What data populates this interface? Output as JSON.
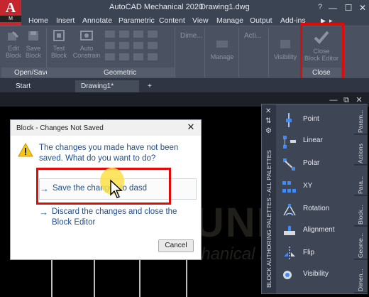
{
  "app": {
    "title": "AutoCAD Mechanical 2020",
    "document": "Drawing1.dwg",
    "logo_letter": "A",
    "logo_sub": "M",
    "brand_color": "#c6262e"
  },
  "quick_access": [
    "?",
    "▶"
  ],
  "window_controls": [
    "—",
    "☐",
    "✕"
  ],
  "ribbon_tabs": [
    "Home",
    "Insert",
    "Annotate",
    "Parametric",
    "Content",
    "View",
    "Manage",
    "Output",
    "Add-ins"
  ],
  "ribbon_tab_more": "▸",
  "ribbon": {
    "open_save": {
      "buttons": [
        {
          "label1": "Edit",
          "label2": "Block"
        },
        {
          "label1": "Save",
          "label2": "Block"
        }
      ],
      "title": "Open/Save"
    },
    "test_block": {
      "label1": "Test",
      "label2": "Block"
    },
    "auto_constrain": {
      "label1": "Auto",
      "label2": "Constrain"
    },
    "geometric": {
      "title": "Geometric"
    },
    "dimension": {
      "label": "Dime..."
    },
    "manage": {
      "label": "Manage"
    },
    "actions": {
      "label": "Acti..."
    },
    "visibility": {
      "label": "Visibility"
    },
    "close": {
      "label1": "Close",
      "label2": "Block Editor",
      "title": "Close"
    }
  },
  "file_tabs": [
    {
      "label": "Start"
    },
    {
      "label": "Drawing1*"
    }
  ],
  "new_tab": "+",
  "dialog": {
    "title": "Block - Changes Not Saved",
    "close": "✕",
    "message": "The changes you made have not been saved. What do you want to do?",
    "option_save": "Save the changes to dasd",
    "option_discard": "Discard the changes and close the Block Editor",
    "arrow": "→",
    "cancel": "Cancel"
  },
  "palette": {
    "title": "BLOCK AUTHORING PALETTES - ALL PALETTES",
    "items": [
      "Point",
      "Linear",
      "Polar",
      "XY",
      "Rotation",
      "Alignment",
      "Flip",
      "Visibility"
    ],
    "tabs": [
      "Param...",
      "Actions",
      "Para...",
      "Block...",
      "Geome...",
      "Dimen..."
    ],
    "controls": [
      "✕",
      "⇅",
      "⚙"
    ]
  },
  "canvas_controls": [
    "—",
    "⧉",
    "✕"
  ],
  "watermark": {
    "big": "DUNI",
    "small": "Mechanical Design"
  },
  "highlight_color": "#e00a0a"
}
